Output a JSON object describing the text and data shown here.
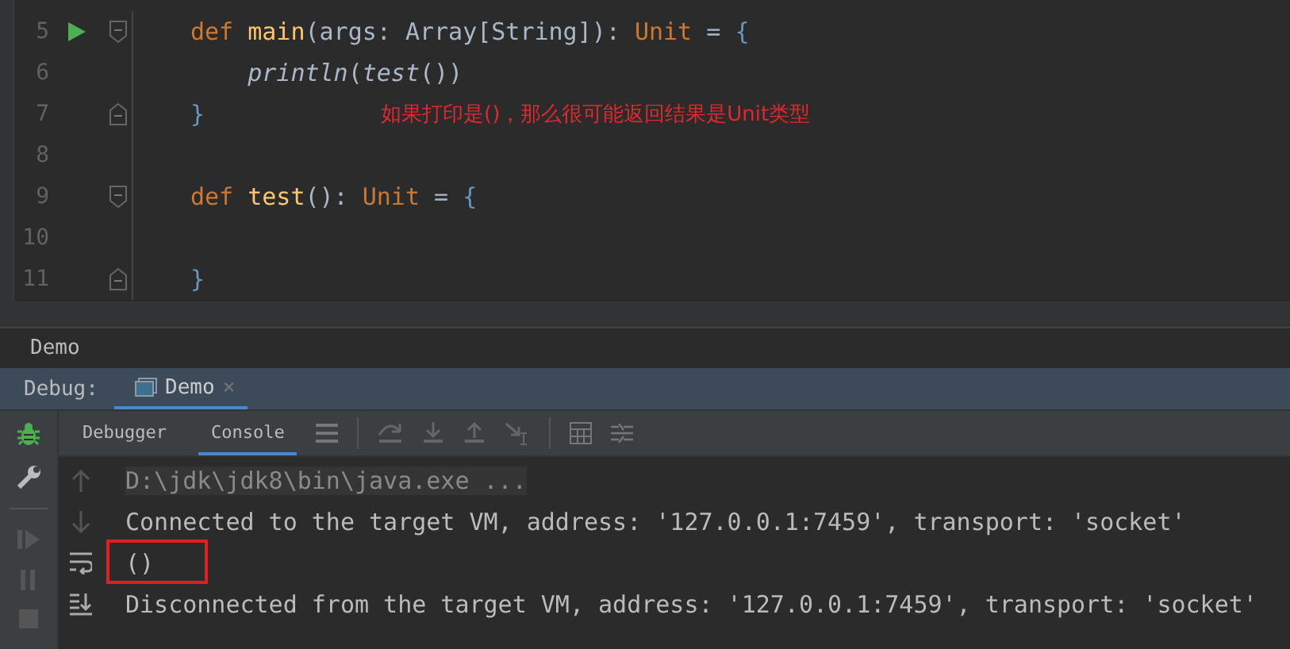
{
  "editor": {
    "lines": [
      {
        "number": "5",
        "run": true,
        "kind": "opener",
        "tokens": [
          {
            "kind": "keyword",
            "text": "def "
          },
          {
            "kind": "function",
            "text": "main"
          },
          {
            "kind": "plain",
            "text": "(args: Array[String]): "
          },
          {
            "kind": "keyword",
            "text": "Unit"
          },
          {
            "kind": "plain",
            "text": " = "
          },
          {
            "kind": "brace",
            "text": "{"
          }
        ]
      },
      {
        "number": "6",
        "run": false,
        "kind": "body",
        "tokens": [
          {
            "kind": "italic",
            "text": "    println"
          },
          {
            "kind": "plain",
            "text": "("
          },
          {
            "kind": "italic",
            "text": "test"
          },
          {
            "kind": "plain",
            "text": "())"
          }
        ]
      },
      {
        "number": "7",
        "run": false,
        "kind": "closer",
        "tokens": [
          {
            "kind": "brace",
            "text": "}"
          }
        ],
        "note": "如果打印是()，那么很可能返回结果是Unit类型"
      },
      {
        "number": "8",
        "run": false,
        "kind": "body"
      },
      {
        "number": "9",
        "run": false,
        "kind": "opener",
        "tokens": [
          {
            "kind": "keyword",
            "text": "def "
          },
          {
            "kind": "function",
            "text": "test"
          },
          {
            "kind": "plain",
            "text": "(): "
          },
          {
            "kind": "keyword",
            "text": "Unit"
          },
          {
            "kind": "plain",
            "text": " = "
          },
          {
            "kind": "brace",
            "text": "{"
          }
        ]
      },
      {
        "number": "10",
        "run": false,
        "kind": "body"
      },
      {
        "number": "11",
        "run": false,
        "kind": "closer",
        "tokens": [
          {
            "kind": "brace",
            "text": "}"
          }
        ]
      }
    ]
  },
  "run_title": "Demo",
  "debug": {
    "label": "Debug:",
    "tabs": [
      {
        "label": "Demo",
        "selected": true,
        "close": "×"
      }
    ]
  },
  "subtabs": [
    {
      "label": "Debugger",
      "selected": false
    },
    {
      "label": "Console",
      "selected": true
    }
  ],
  "console": {
    "lines": [
      {
        "kind": "command",
        "text": "D:\\jdk\\jdk8\\bin\\java.exe ..."
      },
      {
        "kind": "output",
        "text": "Connected to the target VM, address: '127.0.0.1:7459', transport: 'socket'"
      },
      {
        "kind": "output",
        "text": "()",
        "highlighted": true
      },
      {
        "kind": "output",
        "text": "Disconnected from the target VM, address: '127.0.0.1:7459', transport: 'socket'"
      }
    ]
  }
}
